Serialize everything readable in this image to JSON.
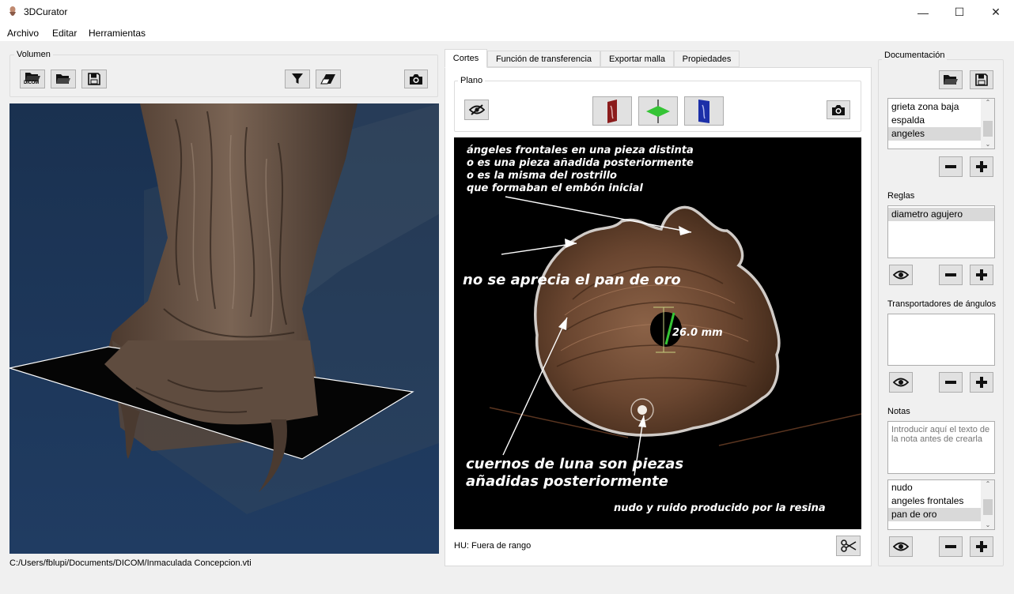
{
  "window": {
    "title": "3DCurator",
    "controls": {
      "minimize": "—",
      "maximize": "☐",
      "close": "✕"
    }
  },
  "menu": [
    "Archivo",
    "Editar",
    "Herramientas"
  ],
  "volume_panel": {
    "label": "Volumen",
    "dicom_badge": "DICOM",
    "file_path": "C:/Users/fblupi/Documents/DICOM/Inmaculada Concepcion.vti"
  },
  "tabs": [
    "Cortes",
    "Función de transferencia",
    "Exportar malla",
    "Propiedades"
  ],
  "active_tab": 0,
  "plane_panel": {
    "label": "Plano",
    "hu_status": "HU: Fuera de rango"
  },
  "slice_annotations": {
    "top_text": [
      "ángeles frontales en una pieza distinta",
      "o es una pieza añadida posteriormente",
      "o es la misma del rostrillo",
      "que formaban el embón inicial"
    ],
    "gold": "no se aprecia el pan de oro",
    "measure": "26.0   mm",
    "horns": [
      "cuernos de luna son piezas",
      "añadidas posteriormente"
    ],
    "knot": "nudo y ruido producido por la resina"
  },
  "documentation": {
    "label": "Documentación",
    "segments": [
      "grieta zona baja",
      "espalda",
      "angeles"
    ],
    "segments_selected": 2,
    "rules_label": "Reglas",
    "rules": [
      "diametro agujero"
    ],
    "rules_selected": 0,
    "protractors_label": "Transportadores de ángulos",
    "protractors": [],
    "notes_label": "Notas",
    "note_placeholder": "Introducir aquí el texto de la nota antes de crearla",
    "notes": [
      "nudo",
      "angeles frontales",
      "pan de oro"
    ],
    "notes_selected": 2
  },
  "colors": {
    "viewport_bg": "#1c3555",
    "wood": "#6b4a35",
    "accent_green": "#35c435"
  },
  "icons": [
    "app-icon",
    "open-dicom-icon",
    "open-folder-icon",
    "save-icon",
    "filter-icon",
    "eraser-icon",
    "camera-icon",
    "eye-slash-icon",
    "sagittal-plane-icon",
    "axial-plane-icon",
    "coronal-plane-icon",
    "scissors-icon",
    "eye-icon",
    "minus-icon",
    "plus-icon"
  ]
}
